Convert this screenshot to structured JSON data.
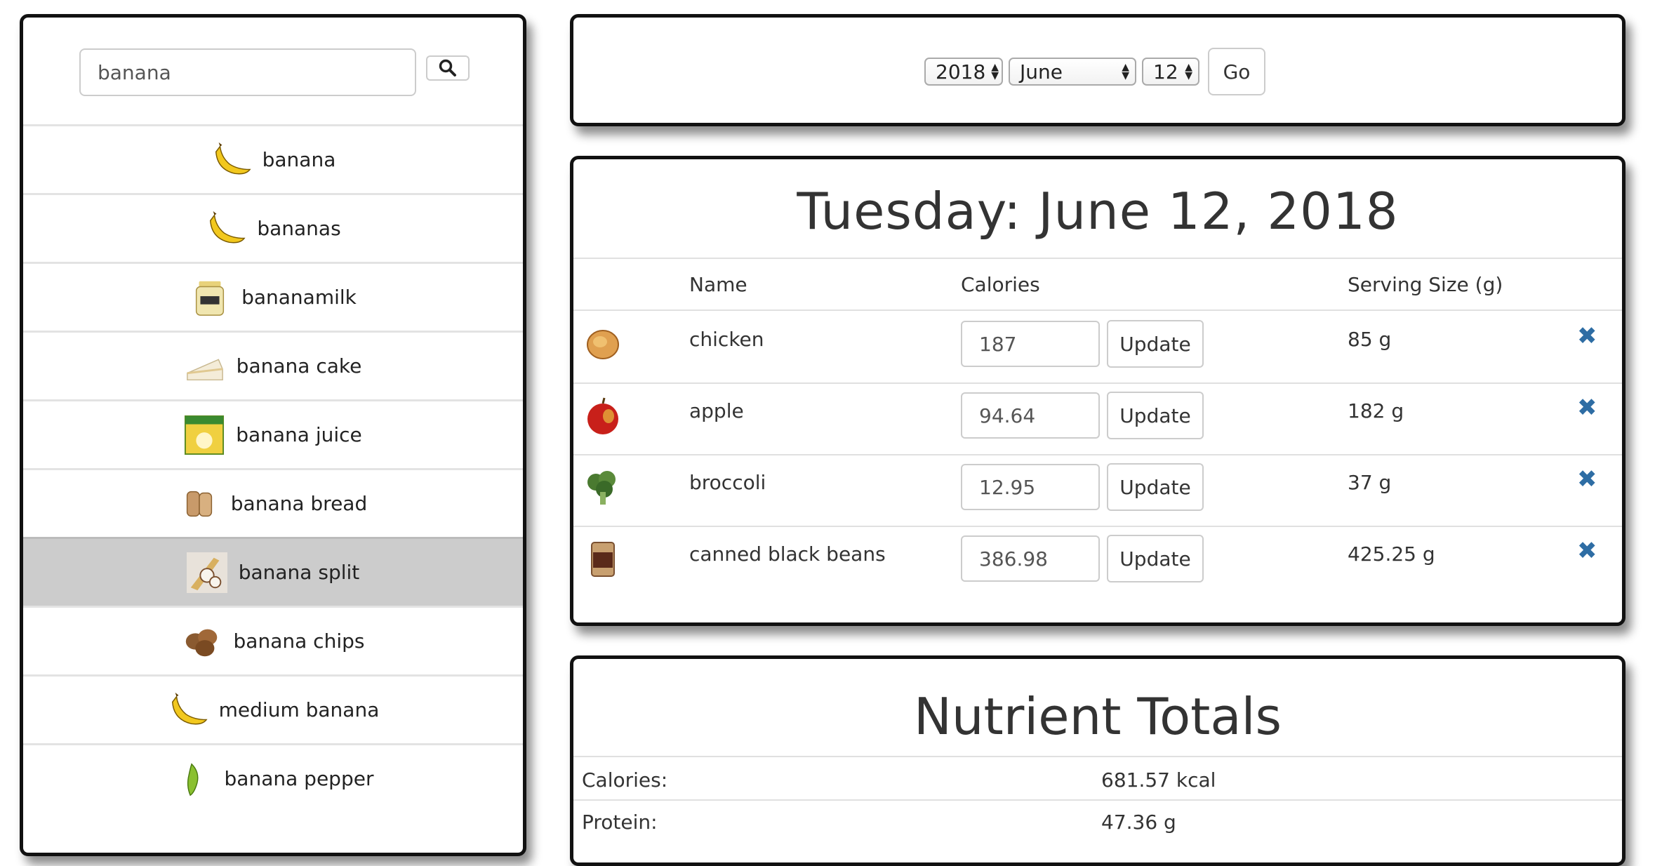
{
  "search": {
    "value": "banana",
    "icon": "search-icon"
  },
  "results": [
    {
      "label": "banana",
      "icon": "banana-icon"
    },
    {
      "label": "bananas",
      "icon": "banana-icon"
    },
    {
      "label": "bananamilk",
      "icon": "milk-jug-icon"
    },
    {
      "label": "banana cake",
      "icon": "cake-slice-icon"
    },
    {
      "label": "banana juice",
      "icon": "juice-box-icon"
    },
    {
      "label": "banana bread",
      "icon": "bread-icon"
    },
    {
      "label": "banana split",
      "icon": "banana-split-icon",
      "selected": true
    },
    {
      "label": "banana chips",
      "icon": "chips-icon"
    },
    {
      "label": "medium banana",
      "icon": "banana-icon"
    },
    {
      "label": "banana pepper",
      "icon": "pepper-icon"
    }
  ],
  "date_picker": {
    "year": "2018",
    "month": "June",
    "day": "12",
    "go_label": "Go"
  },
  "day": {
    "title": "Tuesday: June 12, 2018",
    "headers": {
      "name": "Name",
      "calories": "Calories",
      "serving": "Serving Size (g)"
    },
    "update_label": "Update",
    "rows": [
      {
        "name": "chicken",
        "calories": "187",
        "serving": "85 g",
        "icon": "chicken-icon"
      },
      {
        "name": "apple",
        "calories": "94.64",
        "serving": "182 g",
        "icon": "apple-icon"
      },
      {
        "name": "broccoli",
        "calories": "12.95",
        "serving": "37 g",
        "icon": "broccoli-icon"
      },
      {
        "name": "canned black beans",
        "calories": "386.98",
        "serving": "425.25 g",
        "icon": "canned-beans-icon"
      }
    ]
  },
  "nutrients": {
    "title": "Nutrient Totals",
    "rows": [
      {
        "label": "Calories:",
        "value": "681.57 kcal"
      },
      {
        "label": "Protein:",
        "value": "47.36 g"
      }
    ]
  },
  "colors": {
    "delete": "#2e6da4",
    "selected_row": "#cccccc",
    "panel_border": "#111111"
  }
}
